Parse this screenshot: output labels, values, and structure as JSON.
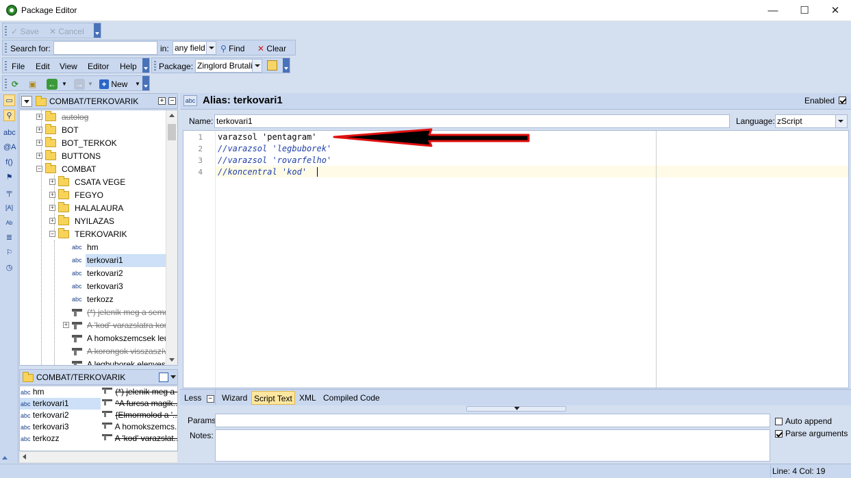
{
  "window": {
    "title": "Package Editor",
    "minimize": "—",
    "maximize": "☐",
    "close": "✕"
  },
  "toolbar1": {
    "save_label": "Save",
    "cancel_label": "Cancel"
  },
  "search": {
    "label": "Search for:",
    "value": "",
    "in_label": "in:",
    "field_value": "any field",
    "find_label": "Find",
    "clear_label": "Clear"
  },
  "menu": {
    "file": "File",
    "edit": "Edit",
    "view": "View",
    "editor": "Editor",
    "help": "Help",
    "package_label": "Package:",
    "package_value": "Zinglord Brutali"
  },
  "toolbar3": {
    "new_label": "New"
  },
  "tree": {
    "header": "COMBAT/TERKOVARIK",
    "items": [
      {
        "label": "autolog",
        "kind": "folder",
        "level": 1,
        "expander": "+",
        "strike": true
      },
      {
        "label": "BOT",
        "kind": "folder",
        "level": 1,
        "expander": "+",
        "strike": false
      },
      {
        "label": "BOT_TERKOK",
        "kind": "folder",
        "level": 1,
        "expander": "+",
        "strike": false
      },
      {
        "label": "BUTTONS",
        "kind": "folder",
        "level": 1,
        "expander": "+",
        "strike": false
      },
      {
        "label": "COMBAT",
        "kind": "folder",
        "level": 1,
        "expander": "−",
        "strike": false
      },
      {
        "label": "CSATA VEGE",
        "kind": "folder",
        "level": 2,
        "expander": "+",
        "strike": false
      },
      {
        "label": "FEGYO",
        "kind": "folder",
        "level": 2,
        "expander": "+",
        "strike": false
      },
      {
        "label": "HALALAURA",
        "kind": "folder",
        "level": 2,
        "expander": "+",
        "strike": false
      },
      {
        "label": "NYILAZAS",
        "kind": "folder",
        "level": 2,
        "expander": "+",
        "strike": false
      },
      {
        "label": "TERKOVARIK",
        "kind": "folder",
        "level": 2,
        "expander": "−",
        "strike": false
      },
      {
        "label": "hm",
        "kind": "alias",
        "level": 3,
        "expander": "",
        "strike": false
      },
      {
        "label": "terkovari1",
        "kind": "alias",
        "level": 3,
        "expander": "",
        "strike": false,
        "selected": true
      },
      {
        "label": "terkovari2",
        "kind": "alias",
        "level": 3,
        "expander": "",
        "strike": false
      },
      {
        "label": "terkovari3",
        "kind": "alias",
        "level": 3,
        "expander": "",
        "strike": false
      },
      {
        "label": "terkozz",
        "kind": "alias",
        "level": 3,
        "expander": "",
        "strike": false
      },
      {
        "label": "(*) jelenik meg a semr",
        "kind": "trigger",
        "level": 3,
        "expander": "",
        "strike": true
      },
      {
        "label": "A 'kod' varazslatra kor",
        "kind": "trigger",
        "level": 3,
        "expander": "+",
        "strike": true
      },
      {
        "label": "A homokszemcsek leu",
        "kind": "trigger",
        "level": 3,
        "expander": "",
        "strike": false
      },
      {
        "label": "A korongok visszaszív",
        "kind": "trigger",
        "level": 3,
        "expander": "",
        "strike": true
      },
      {
        "label": "A legbuborek elenyes:",
        "kind": "trigger",
        "level": 3,
        "expander": "",
        "strike": false
      }
    ]
  },
  "list": {
    "header": "COMBAT/TERKOVARIK",
    "left": [
      {
        "label": "hm"
      },
      {
        "label": "terkovari1",
        "selected": true
      },
      {
        "label": "terkovari2"
      },
      {
        "label": "terkovari3"
      },
      {
        "label": "terkozz"
      }
    ],
    "right": [
      {
        "label": "(*) jelenik meg a ...",
        "strike": true
      },
      {
        "label": "^A furcsa magik...",
        "strike": true
      },
      {
        "label": "{Elmormolod a '...",
        "strike": true
      },
      {
        "label": "A homokszemcs...",
        "strike": false
      },
      {
        "label": "A 'kod' varazslat...",
        "strike": true
      }
    ]
  },
  "editor": {
    "title": "Alias: terkovari1",
    "enabled_label": "Enabled",
    "name_label": "Name:",
    "name_value": "terkovari1",
    "language_label": "Language:",
    "language_value": "zScript",
    "lines": [
      {
        "num": "1",
        "text": "varazsol 'pentagram'",
        "comment": false
      },
      {
        "num": "2",
        "text": "//varazsol 'legbuborek'",
        "comment": true
      },
      {
        "num": "3",
        "text": "//varazsol 'rovarfelho'",
        "comment": true
      },
      {
        "num": "4",
        "text": "//koncentral 'kod'",
        "comment": true
      }
    ],
    "less_label": "Less",
    "tabs": [
      "Wizard",
      "Script Text",
      "XML",
      "Compiled Code"
    ],
    "active_tab": "Script Text",
    "params_label": "Params:",
    "params_value": "",
    "notes_label": "Notes:",
    "auto_append_label": "Auto append",
    "parse_arguments_label": "Parse arguments"
  },
  "status": {
    "cursor": "Line: 4 Col: 19"
  },
  "colors": {
    "accent": "#4a72b8",
    "selection": "#cde0f7",
    "annotation_arrow": "#e01010"
  }
}
